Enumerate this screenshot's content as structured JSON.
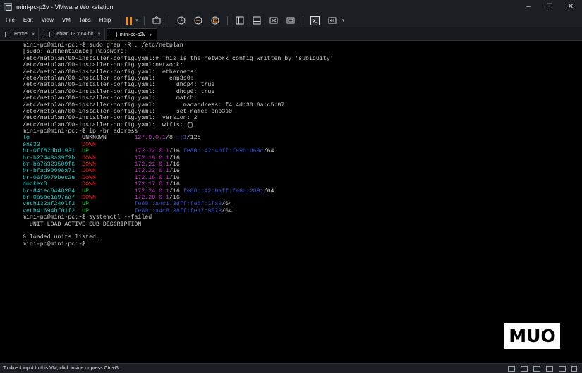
{
  "window": {
    "title": "mini-pc-p2v - VMware Workstation",
    "controls": {
      "minimize": "–",
      "maximize": "☐",
      "close": "✕"
    }
  },
  "menu": [
    "File",
    "Edit",
    "View",
    "VM",
    "Tabs",
    "Help"
  ],
  "tabs": [
    {
      "label": "Home",
      "active": false
    },
    {
      "label": "Debian 13.x 64-bit",
      "active": false
    },
    {
      "label": "mini-pc-p2v",
      "active": true
    }
  ],
  "terminal": {
    "lines": [
      [
        {
          "t": "mini-pc@mini-pc:~$ sudo grep -R . /etc/netplan",
          "c": "white"
        }
      ],
      [
        {
          "t": "[sudo: authenticate] Password:",
          "c": "white"
        }
      ],
      [
        {
          "t": "/etc/netplan/00-installer-config.yaml:# This is the network config written by 'subiquity'",
          "c": "white"
        }
      ],
      [
        {
          "t": "/etc/netplan/00-installer-config.yaml:network:",
          "c": "white"
        }
      ],
      [
        {
          "t": "/etc/netplan/00-installer-config.yaml:  ethernets:",
          "c": "white"
        }
      ],
      [
        {
          "t": "/etc/netplan/00-installer-config.yaml:    enp3s0:",
          "c": "white"
        }
      ],
      [
        {
          "t": "/etc/netplan/00-installer-config.yaml:      dhcp4: true",
          "c": "white"
        }
      ],
      [
        {
          "t": "/etc/netplan/00-installer-config.yaml:      dhcp6: true",
          "c": "white"
        }
      ],
      [
        {
          "t": "/etc/netplan/00-installer-config.yaml:      match:",
          "c": "white"
        }
      ],
      [
        {
          "t": "/etc/netplan/00-installer-config.yaml:        macaddress: f4:4d:30:6a:c5:87",
          "c": "white"
        }
      ],
      [
        {
          "t": "/etc/netplan/00-installer-config.yaml:      set-name: enp3s0",
          "c": "white"
        }
      ],
      [
        {
          "t": "/etc/netplan/00-installer-config.yaml:  version: 2",
          "c": "white"
        }
      ],
      [
        {
          "t": "/etc/netplan/00-installer-config.yaml:  wifis: {}",
          "c": "white"
        }
      ],
      [
        {
          "t": "mini-pc@mini-pc:~$ ip -br address",
          "c": "white"
        }
      ],
      [
        {
          "t": "lo               ",
          "c": "cyan"
        },
        {
          "t": "UNKNOWN        ",
          "c": "white"
        },
        {
          "t": "127.0.0.1",
          "c": "magenta"
        },
        {
          "t": "/8 ",
          "c": "white"
        },
        {
          "t": "::1",
          "c": "blue"
        },
        {
          "t": "/128",
          "c": "white"
        }
      ],
      [
        {
          "t": "ens33            ",
          "c": "cyan"
        },
        {
          "t": "DOWN",
          "c": "red"
        }
      ],
      [
        {
          "t": "br-0ff82dbd1931  ",
          "c": "cyan"
        },
        {
          "t": "UP             ",
          "c": "green"
        },
        {
          "t": "172.22.0.1",
          "c": "magenta"
        },
        {
          "t": "/16 ",
          "c": "white"
        },
        {
          "t": "fe80::42:4bff:fe9b:d69c",
          "c": "blue"
        },
        {
          "t": "/64",
          "c": "white"
        }
      ],
      [
        {
          "t": "br-b27443a39f2b  ",
          "c": "cyan"
        },
        {
          "t": "DOWN           ",
          "c": "red"
        },
        {
          "t": "172.19.0.1",
          "c": "magenta"
        },
        {
          "t": "/16",
          "c": "white"
        }
      ],
      [
        {
          "t": "br-bb7b323509f6  ",
          "c": "cyan"
        },
        {
          "t": "DOWN           ",
          "c": "red"
        },
        {
          "t": "172.21.0.1",
          "c": "magenta"
        },
        {
          "t": "/16",
          "c": "white"
        }
      ],
      [
        {
          "t": "br-bfad90098a71  ",
          "c": "cyan"
        },
        {
          "t": "DOWN           ",
          "c": "red"
        },
        {
          "t": "172.23.0.1",
          "c": "magenta"
        },
        {
          "t": "/16",
          "c": "white"
        }
      ],
      [
        {
          "t": "br-06f5079bec2e  ",
          "c": "cyan"
        },
        {
          "t": "DOWN           ",
          "c": "red"
        },
        {
          "t": "172.18.0.1",
          "c": "magenta"
        },
        {
          "t": "/16",
          "c": "white"
        }
      ],
      [
        {
          "t": "docker0          ",
          "c": "cyan"
        },
        {
          "t": "DOWN           ",
          "c": "red"
        },
        {
          "t": "172.17.0.1",
          "c": "magenta"
        },
        {
          "t": "/16",
          "c": "white"
        }
      ],
      [
        {
          "t": "br-841ec8448284  ",
          "c": "cyan"
        },
        {
          "t": "UP             ",
          "c": "green"
        },
        {
          "t": "172.24.0.1",
          "c": "magenta"
        },
        {
          "t": "/16 ",
          "c": "white"
        },
        {
          "t": "fe80::42:8aff:fe8a:2891",
          "c": "blue"
        },
        {
          "t": "/64",
          "c": "white"
        }
      ],
      [
        {
          "t": "br-0a5be1a97aa7  ",
          "c": "cyan"
        },
        {
          "t": "DOWN           ",
          "c": "red"
        },
        {
          "t": "172.20.0.1",
          "c": "magenta"
        },
        {
          "t": "/16",
          "c": "white"
        }
      ],
      [
        {
          "t": "veth132af240lf2  ",
          "c": "cyan"
        },
        {
          "t": "UP             ",
          "c": "green"
        },
        {
          "t": "fe80::a4c1:3dff:fe8f:1fa3",
          "c": "blue"
        },
        {
          "t": "/64",
          "c": "white"
        }
      ],
      [
        {
          "t": "veth41694bf01f2  ",
          "c": "cyan"
        },
        {
          "t": "UP             ",
          "c": "green"
        },
        {
          "t": "fe80::a4c8:38ff:fe17:9573",
          "c": "blue"
        },
        {
          "t": "/64",
          "c": "white"
        }
      ],
      [
        {
          "t": "mini-pc@mini-pc:~$ systemctl --failed",
          "c": "white"
        }
      ],
      [
        {
          "t": "  UNIT LOAD ACTIVE SUB DESCRIPTION",
          "c": "white"
        }
      ],
      [
        {
          "t": "",
          "c": "white"
        }
      ],
      [
        {
          "t": "0 loaded units listed.",
          "c": "white"
        }
      ],
      [
        {
          "t": "mini-pc@mini-pc:~$ ",
          "c": "white"
        }
      ]
    ]
  },
  "watermark": "MUO",
  "status": {
    "text": "To direct input to this VM, click inside or press Ctrl+G."
  },
  "colors": {
    "chrome": "#1b1f24",
    "terminal_bg": "#000000",
    "cyan": "#2ec9c9",
    "green": "#27c82d",
    "red": "#d9302b",
    "magenta": "#cc37cc",
    "blue": "#3a50d0",
    "pause_accent": "#f08a1c"
  }
}
